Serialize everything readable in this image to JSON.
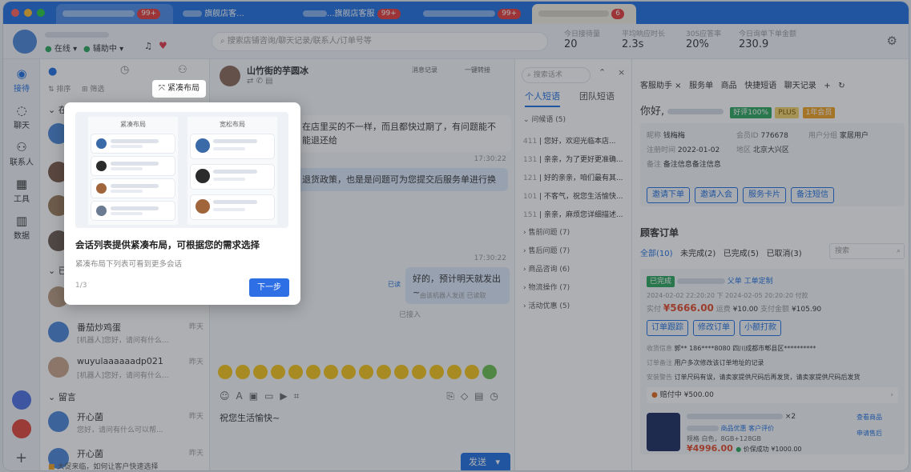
{
  "tabs": [
    {
      "badge": "99+"
    },
    {
      "label": "旗舰店客..."
    },
    {
      "label": "...旗舰店客服",
      "badge": "99+"
    },
    {
      "badge": "99+"
    },
    {
      "badge": "6"
    }
  ],
  "header": {
    "status": "在线",
    "assist": "辅助中",
    "search_placeholder": "搜索店铺咨询/聊天记录/联系人/订单号等",
    "stats": [
      {
        "label": "今日接待量",
        "value": "20"
      },
      {
        "label": "平均响应时长",
        "value": "2.3s"
      },
      {
        "label": "30S应答率",
        "value": "20%"
      },
      {
        "label": "今日询单下单金额",
        "value": "230.9"
      }
    ]
  },
  "leftnav": {
    "items": [
      "接待",
      "聊天",
      "联系人",
      "工具",
      "数据"
    ]
  },
  "sessions": {
    "filter_sort": "排序",
    "filter_mode": "筛选",
    "group_online": "在",
    "group_done": "已",
    "group_message": "留言",
    "items": [
      {
        "name": "番茄炒鸡蛋",
        "preview": "[机器人]您好，请问有什么...",
        "time": "昨天"
      },
      {
        "name": "wuyulaaaaaadp021",
        "preview": "[机器人]您好，请问有什么...",
        "time": "昨天"
      },
      {
        "name": "开心菌",
        "preview": "您好，请问有什么可以帮...",
        "time": "昨天"
      },
      {
        "name": "开心菌",
        "preview": "",
        "time": "昨天"
      }
    ],
    "footer_hint": "大促来临，如何让客户快速选择"
  },
  "chat": {
    "contact_name": "山竹街的芋圆冰",
    "right_actions": [
      "消息记录",
      "一键转接"
    ],
    "messages": [
      {
        "text": "在店里买的不一样，而且都快过期了，有问题能不能退还给"
      },
      {
        "time": "17:30:22"
      },
      {
        "text": "退货政策，也是是问题可为您提交后服务单进行换"
      },
      {
        "time": "17:30:22"
      },
      {
        "text": "好的，预计明天就发出~",
        "status": "已读"
      },
      {
        "note": "由该机器人发送 已读取"
      },
      {
        "system": "已接入"
      }
    ],
    "input_text": "祝您生活愉快~",
    "send_label": "发送"
  },
  "snips": {
    "search_placeholder": "搜索话术",
    "tab_personal": "个人短语",
    "tab_team": "团队短语",
    "group_open": "问候语 (5)",
    "items": [
      {
        "count": "411",
        "text": "您好，欢迎光临本店..."
      },
      {
        "count": "131",
        "text": "亲亲，为了更好更准确..."
      },
      {
        "count": "121",
        "text": "好的亲亲，咱们最有其..."
      },
      {
        "count": "101",
        "text": "不客气，祝您生活愉快..."
      },
      {
        "count": "151",
        "text": "亲亲，麻烦您详细描述..."
      }
    ],
    "groups": [
      "售前问题 (7)",
      "售后问题 (7)",
      "商品咨询 (6)",
      "物流操作 (7)",
      "活动优惠 (5)"
    ]
  },
  "right": {
    "tabs": [
      "客服助手",
      "服务单",
      "商品",
      "快捷短语",
      "聊天记录"
    ],
    "greeting": "你好,",
    "tags": [
      "好评100%",
      "PLUS",
      "1年会员"
    ],
    "info": [
      {
        "label": "昵称",
        "value": "钱梅梅"
      },
      {
        "label": "会员ID",
        "value": "776678"
      },
      {
        "label": "用户分组",
        "value": "家居用户"
      },
      {
        "label": "注册时间",
        "value": "2022-01-02"
      },
      {
        "label": "地区",
        "value": "北京大兴区"
      },
      {
        "label": "备注",
        "value": "备注信息备注信息"
      }
    ],
    "buttons": [
      "邀请下单",
      "邀请入会",
      "服务卡片",
      "备注短信"
    ],
    "orders_title": "顾客订单",
    "order_tabs": [
      "全部(10)",
      "未完成(2)",
      "已完成(5)",
      "已取消(3)"
    ],
    "order_search": "搜索",
    "order": {
      "status": "已完成",
      "type": "父单",
      "tag": "工单定制",
      "date": "2024-02-02 22:20:20 下 2024-02-05 20:20:20 付款",
      "amount_label": "实付",
      "amount": "¥5666.00",
      "discount_label": "运费",
      "discount": "¥10.00",
      "paid_label": "支付金额",
      "paid": "¥105.90",
      "actions": [
        "订单跟踪",
        "修改订单",
        "小额打款"
      ],
      "address_label": "收货信息",
      "address": "郭**  186****8080  四川成都市郫县区**********",
      "note_label": "订单备注",
      "note": "用户多次修改该订单地址的记录",
      "warn_label": "安装警告",
      "warn": "订单尺码有误，请卖家提供尺码后再发货，请卖家提供尺码后发货",
      "refund": "赔付中 ¥500.00",
      "product_spec": "规格 白色，8GB+128GB",
      "product_price": "¥4996.00",
      "product_status": "价保成功 ¥1000.00",
      "product_tags": [
        "商品优惠",
        "客户评价"
      ],
      "product_qty": "×2",
      "product_actions": [
        "查看商品",
        "申请售后"
      ]
    }
  },
  "guide": {
    "pill_label": "紧凑布局",
    "col_left": "紧凑布局",
    "col_right": "宽松布局",
    "title": "会话列表提供紧凑布局，可根据您的需求选择",
    "subtitle": "紧凑布局下列表可看到更多会话",
    "step": "1/3",
    "next_label": "下一步"
  },
  "colors": {
    "brand": "#1f6fe0",
    "price": "#e24a2a",
    "success": "#2aa55c"
  }
}
